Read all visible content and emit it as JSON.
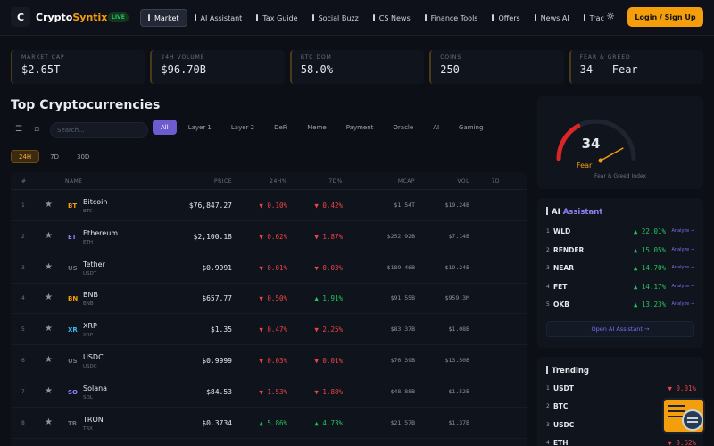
{
  "header": {
    "logo_letter": "C",
    "brand_main": "Crypto",
    "brand_accent": "Syntix",
    "live_badge": "LIVE",
    "nav": [
      {
        "label": "Market",
        "active": true
      },
      {
        "label": "AI Assistant"
      },
      {
        "label": "Tax Guide"
      },
      {
        "label": "Social Buzz"
      },
      {
        "label": "CS News"
      },
      {
        "label": "Finance Tools"
      },
      {
        "label": "Offers"
      },
      {
        "label": "News AI"
      },
      {
        "label": "Trac"
      }
    ],
    "theme_icon": "sun-icon",
    "login_label": "Login / Sign Up"
  },
  "stats": [
    {
      "label": "MARKET CAP",
      "value": "$2.65T"
    },
    {
      "label": "24H VOLUME",
      "value": "$96.70B"
    },
    {
      "label": "BTC DOM",
      "value": "58.0%"
    },
    {
      "label": "COINS",
      "value": "250"
    },
    {
      "label": "FEAR & GREED",
      "value": "34 — Fear"
    }
  ],
  "main": {
    "title": "Top Cryptocurrencies",
    "search_placeholder": "Search...",
    "categories": [
      "All",
      "Layer 1",
      "Layer 2",
      "DeFi",
      "Meme",
      "Payment",
      "Oracle",
      "AI",
      "Gaming"
    ],
    "periods": [
      "24H",
      "7D",
      "30D"
    ],
    "columns": [
      "#",
      "NAME",
      "PRICE",
      "24H%",
      "7D%",
      "MCAP",
      "VOL",
      "7D"
    ],
    "rows": [
      {
        "rank": "1",
        "icon": "BT",
        "color": "#f59e0b",
        "name": "Bitcoin",
        "symbol": "BTC",
        "price": "$76,847.27",
        "ch24": "▼ 0.10%",
        "ch24_dir": "down",
        "ch7": "▼ 0.42%",
        "ch7_dir": "down",
        "mcap": "$1.54T",
        "vol": "$19.24B"
      },
      {
        "rank": "2",
        "icon": "ET",
        "color": "#8b7ff0",
        "name": "Ethereum",
        "symbol": "ETH",
        "price": "$2,100.18",
        "ch24": "▼ 0.62%",
        "ch24_dir": "down",
        "ch7": "▼ 1.87%",
        "ch7_dir": "down",
        "mcap": "$252.92B",
        "vol": "$7.14B"
      },
      {
        "rank": "3",
        "icon": "US",
        "color": "#6b7280",
        "name": "Tether",
        "symbol": "USDT",
        "price": "$0.9991",
        "ch24": "▼ 0.01%",
        "ch24_dir": "down",
        "ch7": "▼ 0.03%",
        "ch7_dir": "down",
        "mcap": "$189.46B",
        "vol": "$19.24B"
      },
      {
        "rank": "4",
        "icon": "BN",
        "color": "#f59e0b",
        "name": "BNB",
        "symbol": "BNB",
        "price": "$657.77",
        "ch24": "▼ 0.50%",
        "ch24_dir": "down",
        "ch7": "▲ 1.91%",
        "ch7_dir": "up",
        "mcap": "$91.55B",
        "vol": "$959.3M"
      },
      {
        "rank": "5",
        "icon": "XR",
        "color": "#38bdf8",
        "name": "XRP",
        "symbol": "XRP",
        "price": "$1.35",
        "ch24": "▼ 0.47%",
        "ch24_dir": "down",
        "ch7": "▼ 2.25%",
        "ch7_dir": "down",
        "mcap": "$83.37B",
        "vol": "$1.08B"
      },
      {
        "rank": "6",
        "icon": "US",
        "color": "#6b7280",
        "name": "USDC",
        "symbol": "USDC",
        "price": "$0.9999",
        "ch24": "▼ 0.03%",
        "ch24_dir": "down",
        "ch7": "▼ 0.01%",
        "ch7_dir": "down",
        "mcap": "$76.39B",
        "vol": "$13.50B"
      },
      {
        "rank": "7",
        "icon": "SO",
        "color": "#8b7ff0",
        "name": "Solana",
        "symbol": "SOL",
        "price": "$84.53",
        "ch24": "▼ 1.53%",
        "ch24_dir": "down",
        "ch7": "▼ 1.88%",
        "ch7_dir": "down",
        "mcap": "$48.88B",
        "vol": "$1.52B"
      },
      {
        "rank": "8",
        "icon": "TR",
        "color": "#6b7280",
        "name": "TRON",
        "symbol": "TRX",
        "price": "$0.3734",
        "ch24": "▲ 5.86%",
        "ch24_dir": "up",
        "ch7": "▲ 4.73%",
        "ch7_dir": "up",
        "mcap": "$21.57B",
        "vol": "$1.37B"
      }
    ]
  },
  "fear_greed": {
    "value": "34",
    "label": "Fear",
    "caption": "Fear & Greed Index",
    "level": 34
  },
  "ai_assistant": {
    "title_main": "AI",
    "title_accent": "Assistant",
    "items": [
      {
        "rank": "1",
        "symbol": "WLD",
        "change": "▲ 22.01%",
        "link": "Analyze →"
      },
      {
        "rank": "2",
        "symbol": "RENDER",
        "change": "▲ 15.05%",
        "link": "Analyze →"
      },
      {
        "rank": "3",
        "symbol": "NEAR",
        "change": "▲ 14.70%",
        "link": "Analyze →"
      },
      {
        "rank": "4",
        "symbol": "FET",
        "change": "▲ 14.17%",
        "link": "Analyze →"
      },
      {
        "rank": "5",
        "symbol": "OKB",
        "change": "▲ 13.23%",
        "link": "Analyze →"
      }
    ],
    "open_label": "Open AI Assistant →"
  },
  "trending": {
    "title": "Trending",
    "items": [
      {
        "rank": "1",
        "symbol": "USDT",
        "change": "▼ 0.01%",
        "dir": "down"
      },
      {
        "rank": "2",
        "symbol": "BTC",
        "change": "",
        "dir": "down"
      },
      {
        "rank": "3",
        "symbol": "USDC",
        "change": "",
        "dir": "down"
      },
      {
        "rank": "4",
        "symbol": "ETH",
        "change": "▼ 0.62%",
        "dir": "down"
      }
    ]
  },
  "colors": {
    "accent": "#f59e0b",
    "purple": "#6d5bd0",
    "up": "#22c55e",
    "down": "#ef4444",
    "background": "#0c0f16"
  }
}
